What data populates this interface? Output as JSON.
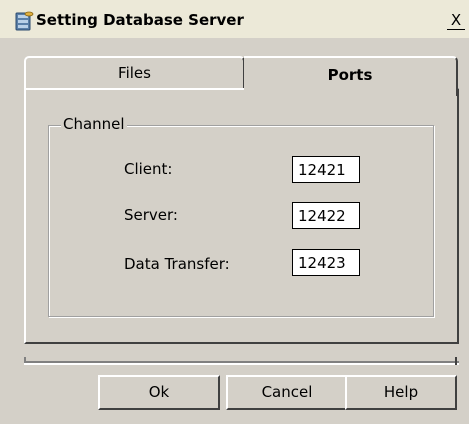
{
  "window": {
    "title": "Setting Database Server",
    "close_label": "X",
    "icon": "database-server-icon"
  },
  "tabs": [
    {
      "label": "Files",
      "active": false
    },
    {
      "label": "Ports",
      "active": true
    }
  ],
  "channel": {
    "legend": "Channel",
    "fields": [
      {
        "label": "Client:",
        "value": "12421"
      },
      {
        "label": "Server:",
        "value": "12422"
      },
      {
        "label": "Data Transfer:",
        "value": "12423"
      }
    ]
  },
  "buttons": {
    "ok": "Ok",
    "cancel": "Cancel",
    "help": "Help"
  },
  "colors": {
    "dialog_bg": "#d4d0c8",
    "titlebar_bg": "#ece9d8",
    "input_bg": "#ffffff"
  }
}
